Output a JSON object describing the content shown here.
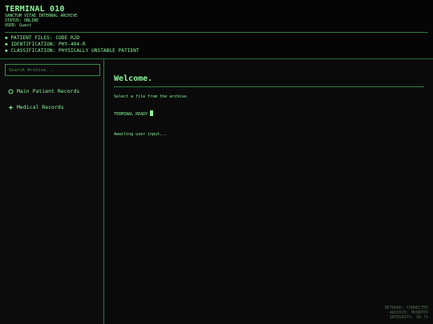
{
  "header": {
    "title": "TERMINAL 010",
    "subtitle": "SANCTUM VITAE INTERNAL ARCHIVE",
    "status": "STATUS: ONLINE",
    "user": "USER: Guest",
    "info": [
      "◆ PATIENT FILES: CODE RJD",
      "◆ IDENTIFICATION: PHY-404-R",
      "◆ CLASSIFICATION: PHYSICALLY UNSTABLE PATIENT"
    ]
  },
  "sidebar": {
    "search_placeholder": "Search Archive...",
    "items": [
      {
        "label": "Main Patient Records",
        "icon": "circle-icon"
      },
      {
        "label": "Medical Records",
        "icon": "plus-icon"
      }
    ]
  },
  "main": {
    "heading": "Welcome.",
    "subtext": "Select a file from the archive.",
    "terminal_ready": "TERMINAL READY",
    "awaiting": "Awaiting user input..."
  },
  "status_bar": {
    "network": "NETWORK: CONNECTED",
    "archive": "ARCHIVE: MOUNTED",
    "integrity": "INTEGRITY: 98.7%"
  },
  "colors": {
    "accent": "#8cf59a",
    "border": "#2f7a3b",
    "background": "#0a0a0a"
  }
}
